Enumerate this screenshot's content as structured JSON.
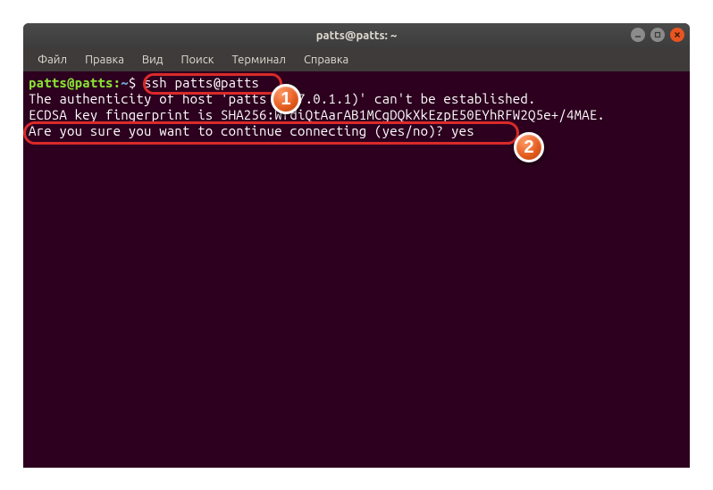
{
  "window": {
    "title": "patts@patts: ~"
  },
  "menu": {
    "file": "Файл",
    "edit": "Правка",
    "view": "Вид",
    "search": "Поиск",
    "terminal": "Терминал",
    "help": "Справка"
  },
  "terminal": {
    "prompt_user": "patts@patts",
    "prompt_colon": ":",
    "prompt_path": "~",
    "prompt_sym": "$",
    "command": "ssh patts@patts",
    "line2": "The authenticity of host 'patts (127.0.1.1)' can't be established.",
    "line3": "ECDSA key fingerprint is SHA256:WfdiQtAarAB1MCgDQkXkEzpE50EYhRFW2Q5e+/4MAE.",
    "line4": "Are you sure you want to continue connecting (yes/no)? yes"
  },
  "callouts": {
    "n1": "1",
    "n2": "2"
  }
}
